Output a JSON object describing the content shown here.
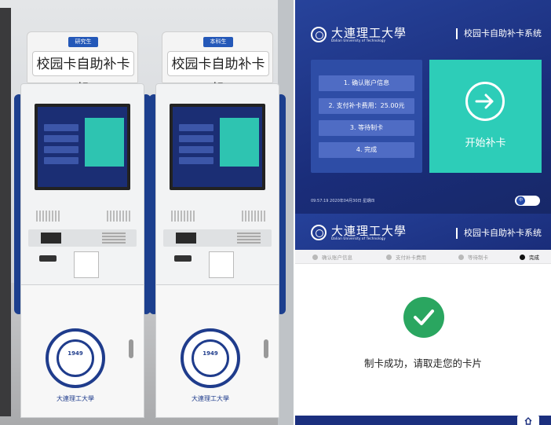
{
  "photo": {
    "kiosk_left": {
      "tag": "研究生",
      "sign": "校园卡自助补卡机",
      "emblem_year": "1949",
      "emblem_script": "大連理工大學"
    },
    "kiosk_right": {
      "tag": "本科生",
      "sign": "校园卡自助补卡机",
      "emblem_year": "1949",
      "emblem_script": "大連理工大學"
    }
  },
  "top_screen": {
    "logo_cn": "大連理工大學",
    "logo_en": "Dalian University of Technology",
    "system_title": "校园卡自助补卡系统",
    "steps": [
      "1. 确认账户信息",
      "2. 支付补卡费用：25.00元",
      "3. 等待制卡",
      "4. 完成"
    ],
    "start_label": "开始补卡",
    "clock": "09:57:19  2020年04月30日  星期四",
    "toggle_label": "中"
  },
  "bottom_screen": {
    "logo_cn": "大連理工大學",
    "logo_en": "Dalian University of Technology",
    "system_title": "校园卡自助补卡系统",
    "progress": [
      {
        "label": "确认账户信息",
        "active": false
      },
      {
        "label": "支付补卡费用",
        "active": false
      },
      {
        "label": "等待制卡",
        "active": false
      },
      {
        "label": "完成",
        "active": true
      }
    ],
    "message": "制卡成功，请取走您的卡片"
  },
  "colors": {
    "brand_blue": "#1a2d7a",
    "accent_teal": "#2dcdb8",
    "success_green": "#2aa660"
  },
  "icons": [
    "arrow-right-circle-icon",
    "checkmark-icon",
    "home-icon",
    "university-seal-icon"
  ]
}
